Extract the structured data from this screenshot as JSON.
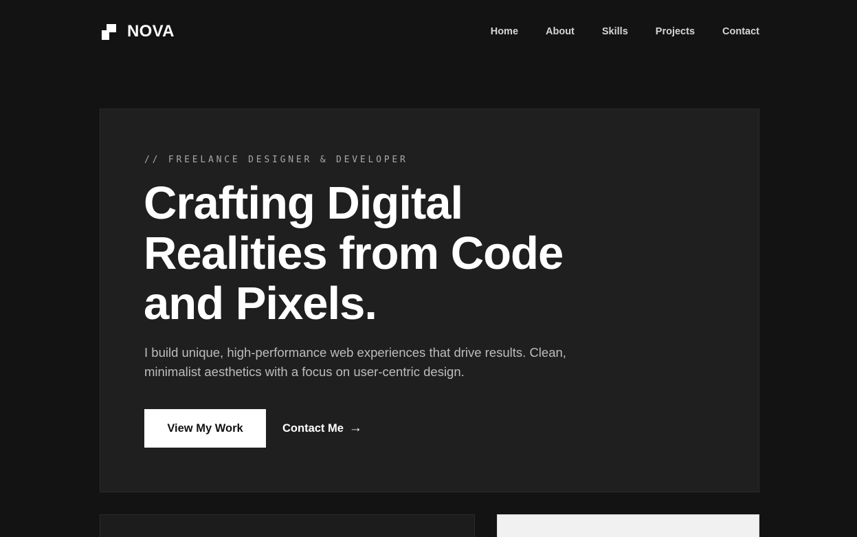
{
  "brand": {
    "name": "NOVA",
    "icon": "nova-logo-icon"
  },
  "nav": {
    "items": [
      {
        "label": "Home"
      },
      {
        "label": "About"
      },
      {
        "label": "Skills"
      },
      {
        "label": "Projects"
      },
      {
        "label": "Contact"
      }
    ]
  },
  "hero": {
    "eyebrow": "// FREELANCE DESIGNER & DEVELOPER",
    "headline_lines": [
      "Crafting Digital",
      "Realities from Code",
      "and Pixels."
    ],
    "lead": "I build unique, high-performance web experiences that drive results. Clean, minimalist aesthetics with a focus on user-centric design.",
    "primary_cta": "View My Work",
    "secondary_cta": "Contact Me",
    "secondary_cta_icon": "→"
  },
  "colors": {
    "page_bg": "#131313",
    "card_bg": "#1f1f1f",
    "accent": "#ffffff",
    "muted_text": "#bdbdbd"
  }
}
